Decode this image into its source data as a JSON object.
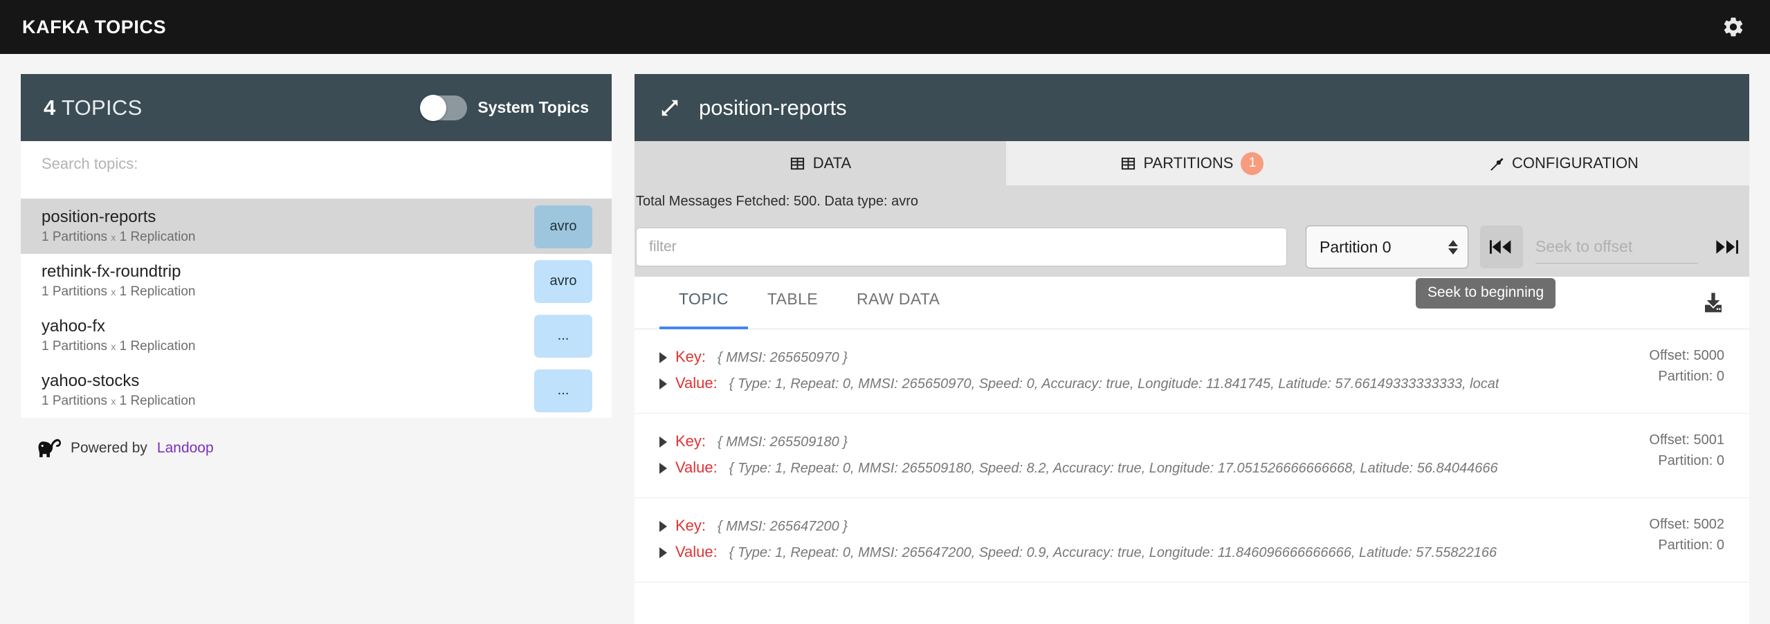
{
  "topbar": {
    "title": "KAFKA TOPICS",
    "settings_icon": "gear-icon"
  },
  "sidebar": {
    "count_number": "4",
    "count_label": " TOPICS",
    "system_topics_label": "System Topics",
    "system_topics_on": false,
    "search": {
      "placeholder": "Search topics:",
      "value": ""
    },
    "topics": [
      {
        "name": "position-reports",
        "meta_partitions": "1 Partitions",
        "meta_sep": "x",
        "meta_replication": "1 Replication",
        "badge": "avro",
        "selected": true
      },
      {
        "name": "rethink-fx-roundtrip",
        "meta_partitions": "1 Partitions",
        "meta_sep": "x",
        "meta_replication": "1 Replication",
        "badge": "avro",
        "selected": false
      },
      {
        "name": "yahoo-fx",
        "meta_partitions": "1 Partitions",
        "meta_sep": "x",
        "meta_replication": "1 Replication",
        "badge": "...",
        "selected": false
      },
      {
        "name": "yahoo-stocks",
        "meta_partitions": "1 Partitions",
        "meta_sep": "x",
        "meta_replication": "1 Replication",
        "badge": "...",
        "selected": false
      }
    ],
    "footer": {
      "powered_prefix": "Powered by ",
      "brand": "Landoop",
      "icon": "elephant-icon"
    }
  },
  "detail": {
    "header": {
      "expand_icon": "expand-arrows-icon",
      "title": "position-reports"
    },
    "tabs": [
      {
        "label": "DATA",
        "icon": "table-grid-icon",
        "active": true,
        "badge": ""
      },
      {
        "label": "PARTITIONS",
        "icon": "table-grid-icon",
        "active": false,
        "badge": "1"
      },
      {
        "label": "CONFIGURATION",
        "icon": "wrench-icon",
        "active": false,
        "badge": ""
      }
    ],
    "fetch_status": "Total Messages Fetched: 500. Data type: avro",
    "controls": {
      "filter_placeholder": "filter",
      "filter_value": "",
      "partition_select_value": "Partition 0",
      "seek_to_beginning_icon": "skip-backward-icon",
      "seek_placeholder": "Seek to offset",
      "seek_value": "",
      "seek_to_end_icon": "skip-forward-icon",
      "tooltip": "Seek to beginning"
    },
    "subtabs": [
      {
        "label": "TOPIC",
        "active": true
      },
      {
        "label": "TABLE",
        "active": false
      },
      {
        "label": "RAW DATA",
        "active": false
      }
    ],
    "download_icon": "download-icon",
    "messages": [
      {
        "key_label": "Key:",
        "key_value": "{ MMSI: 265650970 }",
        "value_label": "Value:",
        "value_value": "{ Type: 1, Repeat: 0, MMSI: 265650970, Speed: 0, Accuracy: true, Longitude: 11.841745, Latitude: 57.66149333333333, locat",
        "offset": "Offset: 5000",
        "partition": "Partition: 0"
      },
      {
        "key_label": "Key:",
        "key_value": "{ MMSI: 265509180 }",
        "value_label": "Value:",
        "value_value": "{ Type: 1, Repeat: 0, MMSI: 265509180, Speed: 8.2, Accuracy: true, Longitude: 17.051526666666668, Latitude: 56.84044666",
        "offset": "Offset: 5001",
        "partition": "Partition: 0"
      },
      {
        "key_label": "Key:",
        "key_value": "{ MMSI: 265647200 }",
        "value_label": "Value:",
        "value_value": "{ Type: 1, Repeat: 0, MMSI: 265647200, Speed: 0.9, Accuracy: true, Longitude: 11.846096666666666, Latitude: 57.55822166",
        "offset": "Offset: 5002",
        "partition": "Partition: 0"
      }
    ]
  },
  "colors": {
    "topbar_bg": "#161616",
    "panel_header_bg": "#3b4c54",
    "accent_blue": "#4285f4",
    "badge_orange": "#f79c7e",
    "badge_avro": "#9ec5de",
    "badge_light": "#bfe1fb",
    "key_red": "#e03232",
    "brand_purple": "#7b2fbe"
  }
}
